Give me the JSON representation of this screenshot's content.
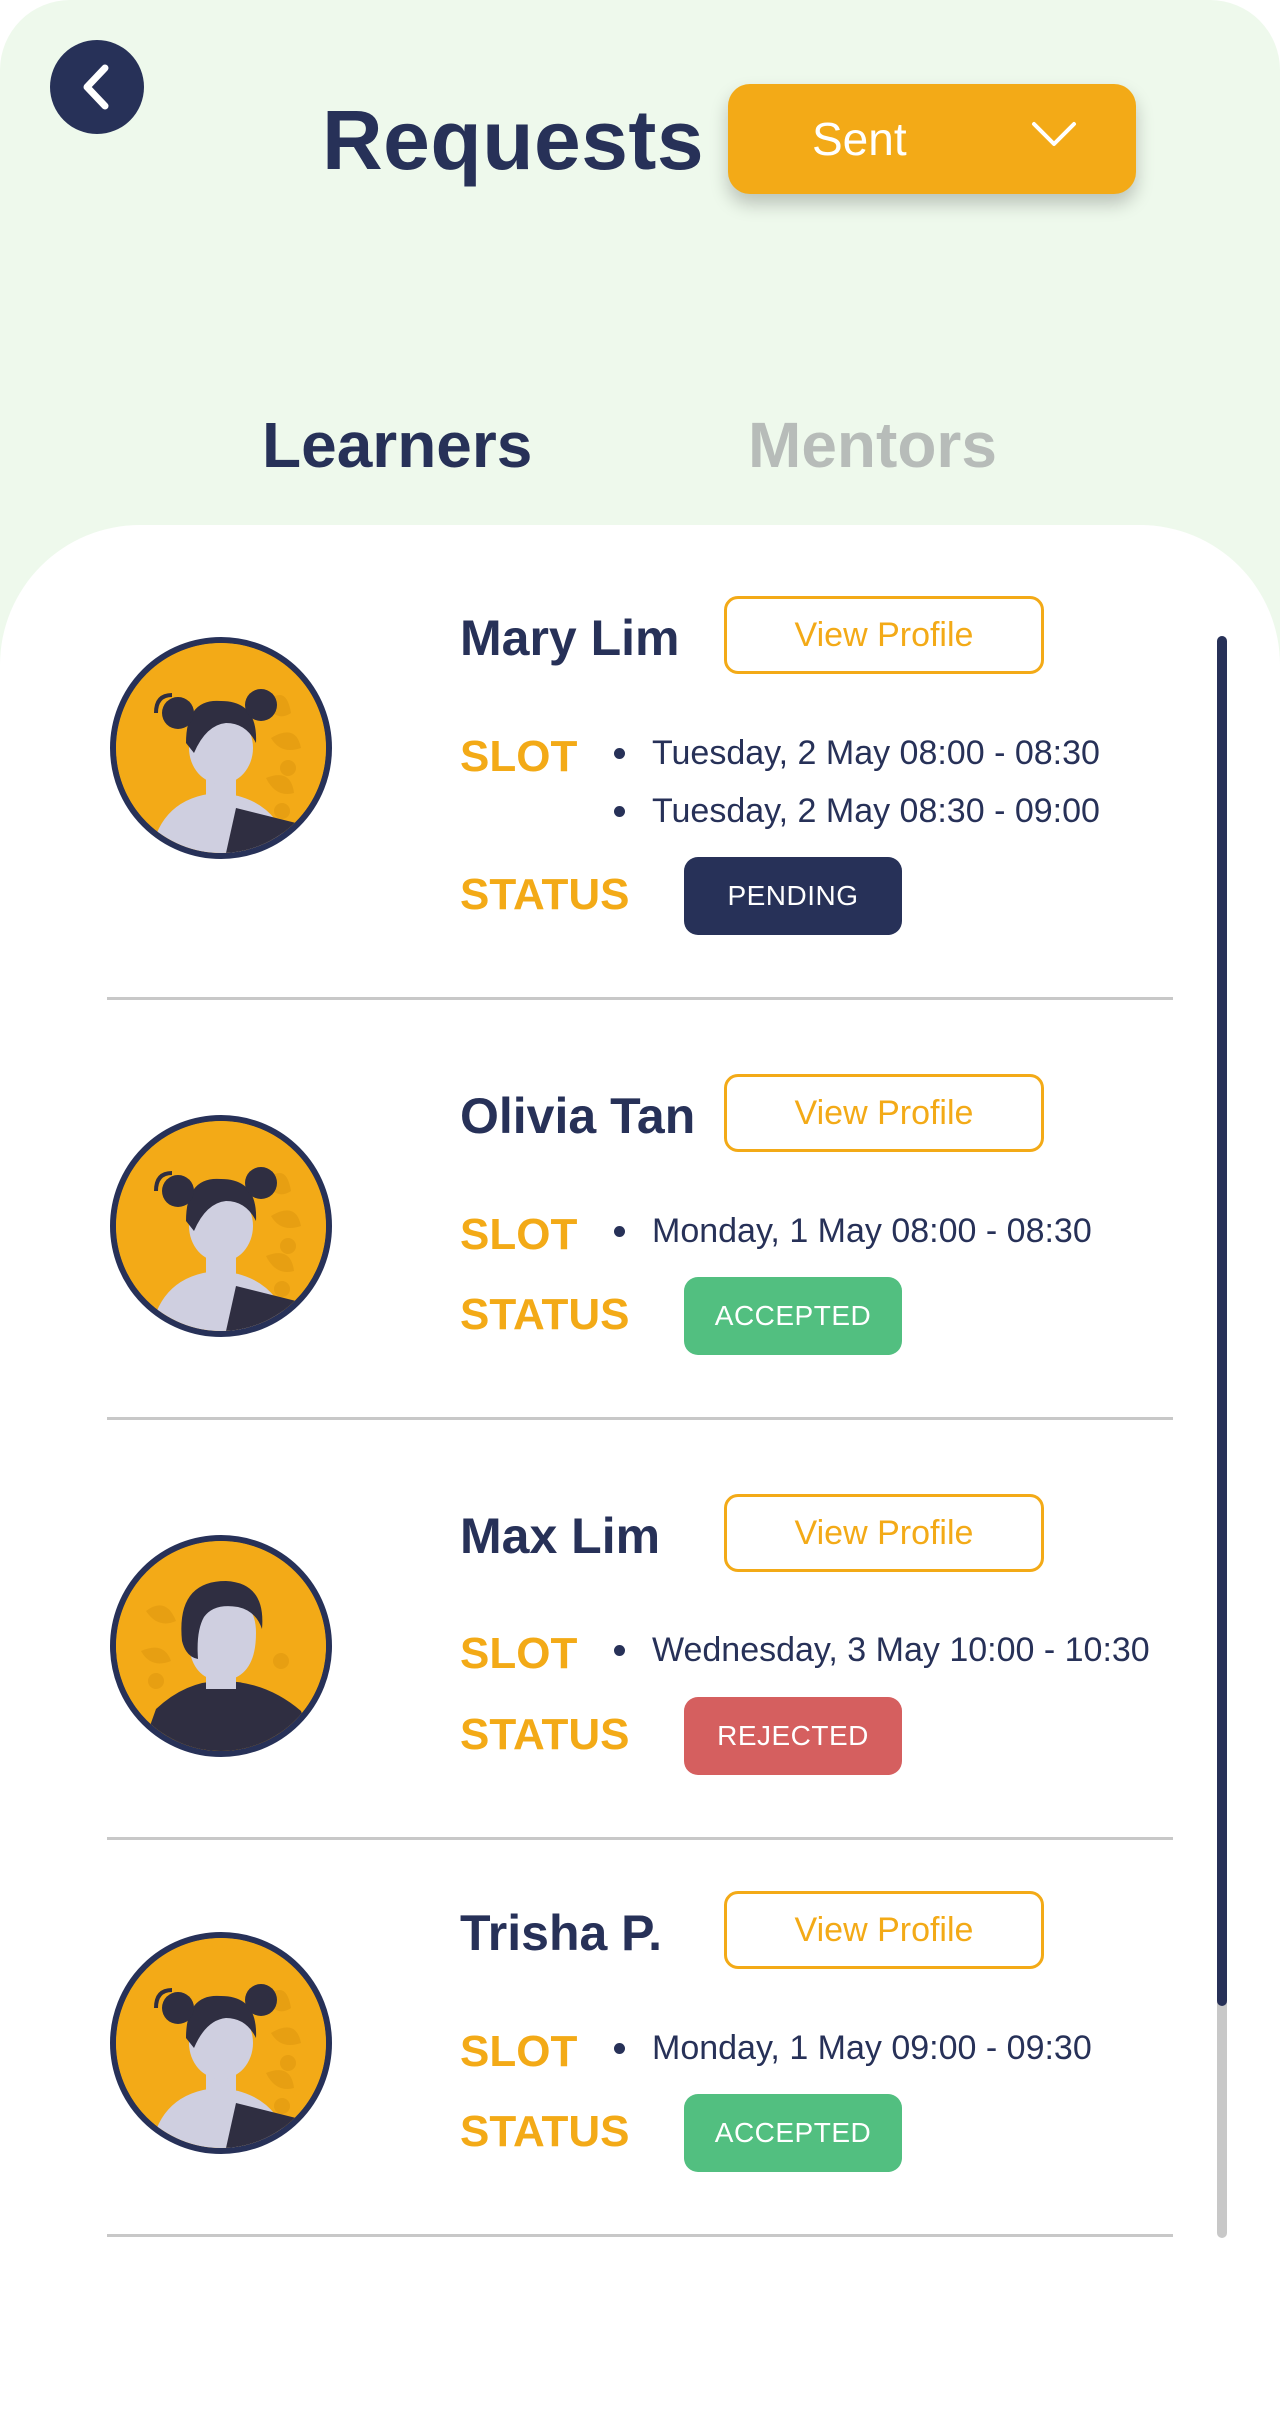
{
  "header": {
    "title": "Requests",
    "dropdown_value": "Sent",
    "back_icon": "chevron-left-icon"
  },
  "tabs": [
    {
      "label": "Learners",
      "active": true
    },
    {
      "label": "Mentors",
      "active": false
    }
  ],
  "labels": {
    "view_profile": "View Profile",
    "slot": "SLOT",
    "status": "STATUS"
  },
  "colors": {
    "navy": "#273158",
    "accent": "#f3aa17",
    "header_bg": "#eef9ec",
    "pending": "#273158",
    "accepted": "#52bf80",
    "rejected": "#d55f5f",
    "inactive_tab": "#b7bcb9"
  },
  "requests": [
    {
      "name": "Mary Lim",
      "avatar": "female-avatar-icon",
      "slots": [
        "Tuesday, 2 May 08:00 - 08:30",
        "Tuesday, 2 May 08:30 - 09:00"
      ],
      "status": "PENDING"
    },
    {
      "name": "Olivia Tan",
      "avatar": "female-avatar-icon",
      "slots": [
        "Monday, 1 May 08:00 - 08:30"
      ],
      "status": "ACCEPTED"
    },
    {
      "name": "Max Lim",
      "avatar": "male-avatar-icon",
      "slots": [
        "Wednesday, 3 May 10:00 - 10:30"
      ],
      "status": "REJECTED"
    },
    {
      "name": "Trisha P.",
      "avatar": "female-avatar-icon",
      "slots": [
        "Monday, 1 May 09:00 - 09:30"
      ],
      "status": "ACCEPTED"
    }
  ]
}
